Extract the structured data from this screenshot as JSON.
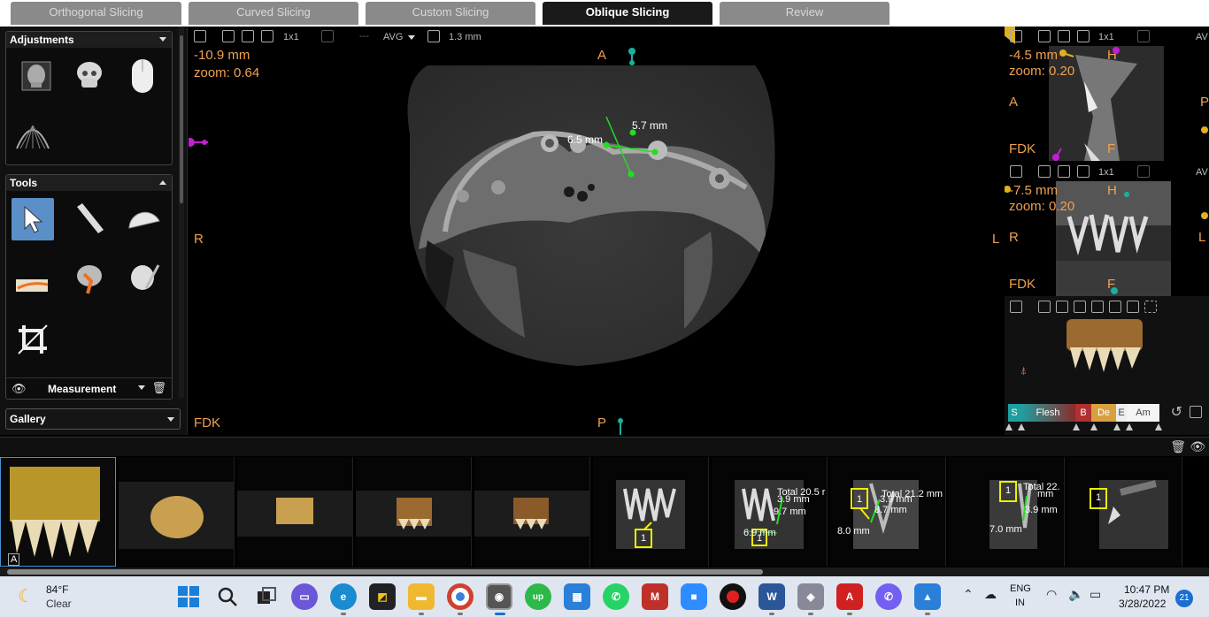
{
  "tabs": [
    {
      "label": "Orthogonal Slicing"
    },
    {
      "label": "Curved Slicing"
    },
    {
      "label": "Custom Slicing"
    },
    {
      "label": "Oblique Slicing"
    },
    {
      "label": "Review"
    }
  ],
  "left_panel": {
    "adjustments_title": "Adjustments",
    "tools_title": "Tools",
    "measurement_label": "Measurement",
    "gallery_label": "Gallery"
  },
  "main_view": {
    "toolbar": {
      "layout": "1x1",
      "dash": "---",
      "mode": "AVG",
      "thickness": "1.3 mm"
    },
    "position": "-10.9 mm",
    "zoom": "zoom: 0.64",
    "label_top": "A",
    "label_left": "R",
    "label_right": "L",
    "label_bottom": "P",
    "label_fdk": "FDK",
    "measure1": "6.5 mm",
    "measure2": "5.7 mm"
  },
  "view_top_right": {
    "layout": "1x1",
    "extra": "AV",
    "position": "-4.5 mm",
    "zoom": "zoom: 0.20",
    "label_left": "A",
    "label_right": "P",
    "label_top": "H",
    "label_bottom": "F",
    "label_fdk": "FDK"
  },
  "view_mid_right": {
    "layout": "1x1",
    "extra": "AV",
    "position": "-7.5 mm",
    "zoom": "zoom: 0.20",
    "label_left": "R",
    "label_right": "L",
    "label_top": "H",
    "label_bottom": "F",
    "label_fdk": "FDK"
  },
  "view_3d": {
    "colorbar": [
      {
        "label": "S",
        "color": "#1fa0a0"
      },
      {
        "label": "Flesh",
        "color": "#8a2c2c"
      },
      {
        "label": "B",
        "color": "#b13030"
      },
      {
        "label": "De",
        "color": "#d8a040"
      },
      {
        "label": "E",
        "color": "#eeeeee"
      },
      {
        "label": "Am",
        "color": "#f4f4f4"
      }
    ]
  },
  "gallery": {
    "thumb_labels": [
      "A",
      "",
      "",
      "",
      "",
      "",
      "",
      "",
      "",
      ""
    ],
    "thumb6": {
      "box": "1"
    },
    "thumb7": {
      "total": "Total 20.5 r",
      "m1": "3.9 mm",
      "m2": "9.7 mm",
      "m3": "6.9 mm",
      "box": "1"
    },
    "thumb8": {
      "total": "Total 21.2 mm",
      "m1": "3.9 mm",
      "m2": "8.7 mm",
      "m3": "8.0 mm",
      "box": "1"
    },
    "thumb9": {
      "total": "Total 22.",
      "m1": "mm",
      "m2": "3.9 mm",
      "m3": "7.0 mm",
      "box": "1"
    },
    "thumb10": {
      "box": "1"
    }
  },
  "taskbar": {
    "weather_temp": "84°F",
    "weather_desc": "Clear",
    "lang1": "ENG",
    "lang2": "IN",
    "time": "10:47 PM",
    "date": "3/28/2022",
    "notif": "21"
  },
  "colors": {
    "accent_orange": "#f0a050",
    "measure_green": "#22dd22",
    "marker_teal": "#1ab0a0",
    "marker_magenta": "#c020d0",
    "marker_gold": "#e0b020"
  }
}
